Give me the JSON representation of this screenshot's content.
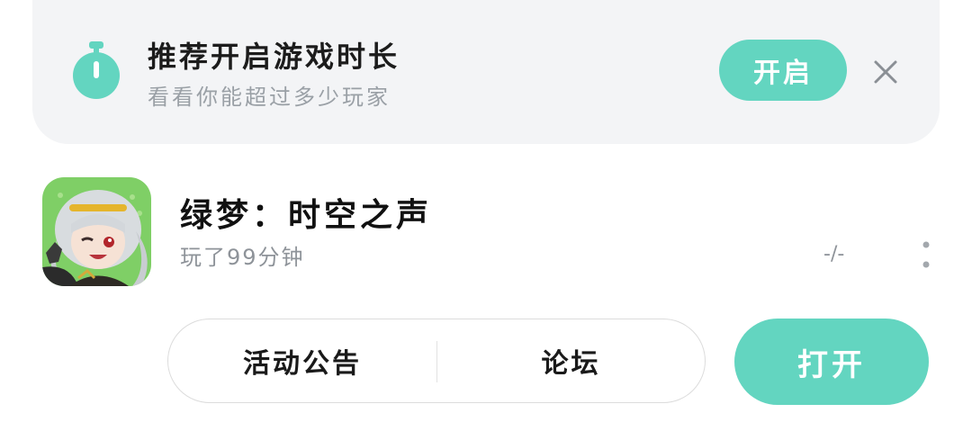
{
  "recommendation": {
    "title": "推荐开启游戏时长",
    "subtitle": "看看你能超过多少玩家",
    "enable_label": "开启",
    "icon": "stopwatch-icon",
    "close_icon": "close-icon",
    "accent": "#63d5c0"
  },
  "game": {
    "title": "绿梦：时空之声",
    "playtime": "玩了99分钟",
    "rank": "-/-",
    "more_icon": "more-vertical-icon",
    "avatar": "game-avatar-image"
  },
  "actions": {
    "announcement_label": "活动公告",
    "forum_label": "论坛",
    "open_label": "打开",
    "accent": "#63d5c0"
  }
}
